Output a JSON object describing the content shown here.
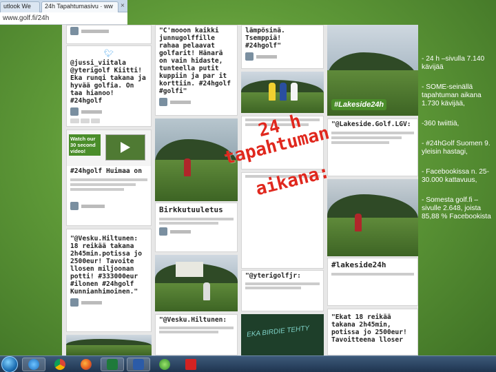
{
  "browser": {
    "tabs": [
      {
        "label": "utlook We"
      },
      {
        "label": "24h Tapahtumasivu · ww"
      }
    ],
    "address": "www.golf.fi/24h"
  },
  "tweets": {
    "t1_text": "@jussi_viitala @yterigolf Kiitti! Eka runqi takana ja hyvää golfia. On taa hianoo! #24hgolf",
    "t2_text": "\"C'mooon kaikki junnugolffille rahaa pelaavat golfarit! Hänarä on vain hidaste, tunteella putit kuppiin ja par it korttiin. #24hgolf #golfi\"",
    "t3_text": "lämpösinä. Tsemppiä! #24hgolf\"",
    "t4_text": "\"@Lakeside.Golf.LGV:",
    "t5_text": "#24hgolf Huimaa on",
    "t6_text": "\"@Vesku.Hiltunen: 18 reikää takana 2h45min.potissa jo 2500eur! Tavoite llosen miljoonan potti! #333000eur #ilonen #24hgolf Kunnianhimoinen.\"",
    "t7_text": "\"@yterigolfjr:",
    "t8_text": "\"@Vesku.Hiltunen:",
    "t9_text": "\"Ekat 18 reikää takana 2h45min, potissa jo 2500eur! Tavoitteena lloser",
    "birk": "Birkkutuuletus",
    "lakeside_tag": "#Lakeside24h",
    "lakeside_tag2": "#lakeside24h",
    "video_promo": "Watch our 30 second video!",
    "photo_caption": "EKA BIRDIE TEHTY"
  },
  "overlay": {
    "line1": "24 h",
    "line2": "tapahtuman",
    "line3": "aikana:"
  },
  "bullets": [
    "- 24 h –sivulla 7.140 kävijää",
    "- SOME-seinällä tapahtuman aikana 1.730 kävijää,",
    "-360 twiittiä,",
    "- #24hGolf Suomen 9. yleisin hastagi,",
    "- Facebookissa n. 25-30.000 kattavuus,",
    "- Somesta golf.fi – sivulle 2.648, joista 85,88 % Facebookista"
  ],
  "taskbar": {
    "apps": [
      "internet-explorer",
      "chrome",
      "firefox",
      "excel",
      "word",
      "media-center",
      "acrobat"
    ]
  }
}
